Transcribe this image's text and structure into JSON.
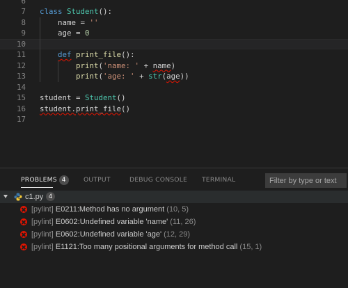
{
  "editor": {
    "lines": [
      {
        "num": "6",
        "tokens": []
      },
      {
        "num": "7",
        "tokens": [
          {
            "t": "class",
            "c": "tok-kw"
          },
          {
            "t": " "
          },
          {
            "t": "Student",
            "c": "tok-cls"
          },
          {
            "t": "():"
          }
        ]
      },
      {
        "num": "8",
        "tokens": [
          {
            "t": "    "
          },
          {
            "t": "name",
            "c": "tok-var"
          },
          {
            "t": " = "
          },
          {
            "t": "''",
            "c": "tok-str"
          }
        ]
      },
      {
        "num": "9",
        "tokens": [
          {
            "t": "    "
          },
          {
            "t": "age",
            "c": "tok-var"
          },
          {
            "t": " = "
          },
          {
            "t": "0",
            "c": "tok-num"
          }
        ]
      },
      {
        "num": "10",
        "tokens": [],
        "current": true
      },
      {
        "num": "11",
        "tokens": [
          {
            "t": "    "
          },
          {
            "t": "def",
            "c": "tok-kw err"
          },
          {
            "t": " "
          },
          {
            "t": "print_file",
            "c": "tok-fn"
          },
          {
            "t": "():"
          }
        ]
      },
      {
        "num": "12",
        "tokens": [
          {
            "t": "        "
          },
          {
            "t": "print",
            "c": "tok-fn"
          },
          {
            "t": "("
          },
          {
            "t": "'name: '",
            "c": "tok-str"
          },
          {
            "t": " + "
          },
          {
            "t": "name",
            "c": "tok-var err"
          },
          {
            "t": ")"
          }
        ]
      },
      {
        "num": "13",
        "tokens": [
          {
            "t": "        "
          },
          {
            "t": "print",
            "c": "tok-fn"
          },
          {
            "t": "("
          },
          {
            "t": "'age: '",
            "c": "tok-str"
          },
          {
            "t": " + "
          },
          {
            "t": "str",
            "c": "tok-cls"
          },
          {
            "t": "("
          },
          {
            "t": "age",
            "c": "tok-var err"
          },
          {
            "t": "))"
          }
        ]
      },
      {
        "num": "14",
        "tokens": []
      },
      {
        "num": "15",
        "tokens": [
          {
            "t": "student",
            "c": "tok-var"
          },
          {
            "t": " = "
          },
          {
            "t": "Student",
            "c": "tok-cls"
          },
          {
            "t": "()"
          }
        ]
      },
      {
        "num": "16",
        "tokens": [
          {
            "t": "student.print_file",
            "c": "tok-var err"
          },
          {
            "t": "()"
          }
        ]
      },
      {
        "num": "17",
        "tokens": []
      }
    ]
  },
  "panel": {
    "tabs": {
      "problems": "PROBLEMS",
      "problems_count": "4",
      "output": "OUTPUT",
      "debug_console": "DEBUG CONSOLE",
      "terminal": "TERMINAL"
    },
    "filter_placeholder": "Filter by type or text",
    "file": {
      "icon": "python-icon",
      "name": "c1.py",
      "count": "4"
    },
    "problems": [
      {
        "icon": "error-icon",
        "source": "[pylint]",
        "message": "E0211:Method has no argument",
        "location": "(10, 5)"
      },
      {
        "icon": "error-icon",
        "source": "[pylint]",
        "message": "E0602:Undefined variable 'name'",
        "location": "(11, 26)"
      },
      {
        "icon": "error-icon",
        "source": "[pylint]",
        "message": "E0602:Undefined variable 'age'",
        "location": "(12, 29)"
      },
      {
        "icon": "error-icon",
        "source": "[pylint]",
        "message": "E1121:Too many positional arguments for method call",
        "location": "(15, 1)"
      }
    ]
  },
  "colors": {
    "background": "#1e1e1e",
    "error": "#e51400",
    "keyword": "#569cd6",
    "class": "#4ec9b0",
    "function": "#dcdcaa",
    "string": "#ce9178",
    "number": "#b5cea8"
  }
}
